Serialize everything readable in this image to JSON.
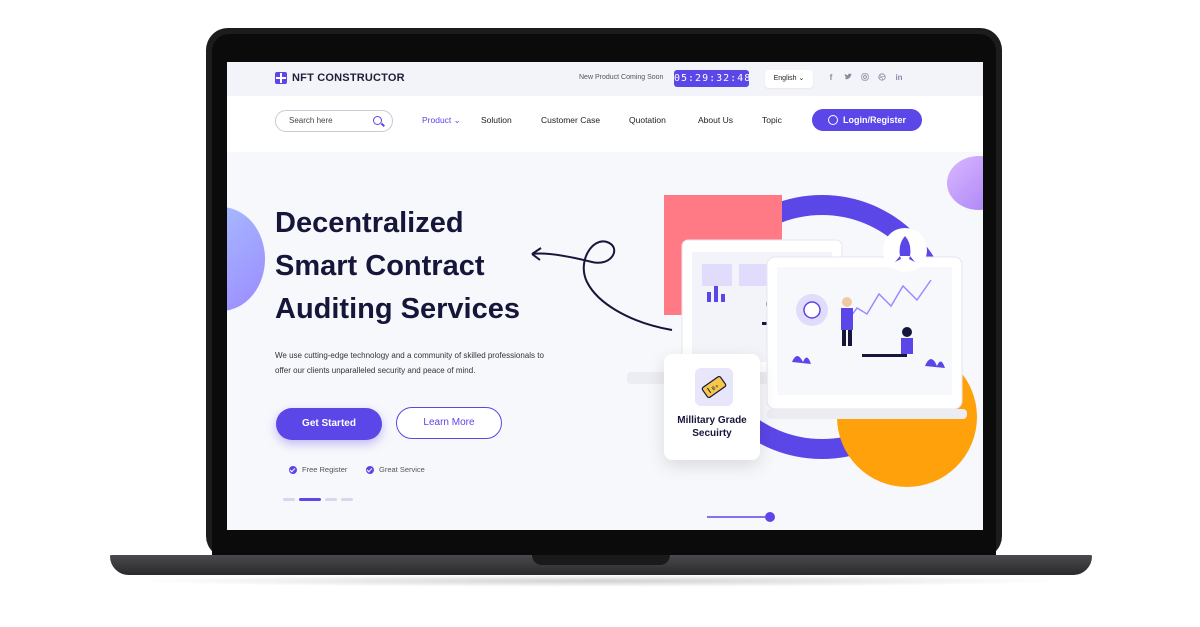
{
  "header": {
    "logo_text": "NFT CONSTRUCTOR",
    "coming_soon": "New Product Coming Soon",
    "countdown": "05:29:32:48",
    "language": "English ⌄",
    "socials": [
      "f",
      "t",
      "ig",
      "dr",
      "in"
    ]
  },
  "nav": {
    "search_placeholder": "Search here",
    "items": [
      "Product ⌄",
      "Solution",
      "Customer Case",
      "Quotation",
      "About Us",
      "Topic"
    ],
    "login_label": "Login/Register"
  },
  "hero": {
    "title_line1": "Decentralized",
    "title_line2": "Smart Contract",
    "title_line3": "Auditing Services",
    "description": "We use cutting-edge technology and a community of skilled professionals to offer our clients unparalleled security and peace of mind.",
    "primary_button": "Get Started",
    "secondary_button": "Learn More",
    "checks": [
      "Free Register",
      "Great Service"
    ],
    "slide_count": 4,
    "active_slide": 2
  },
  "security_card": {
    "line1": "Millitary Grade",
    "line2": "Secuirty"
  },
  "colors": {
    "accent": "#5b46e8",
    "orange": "#ffa10a",
    "coral": "#ff7a85",
    "lavender": "#a47cf5"
  }
}
